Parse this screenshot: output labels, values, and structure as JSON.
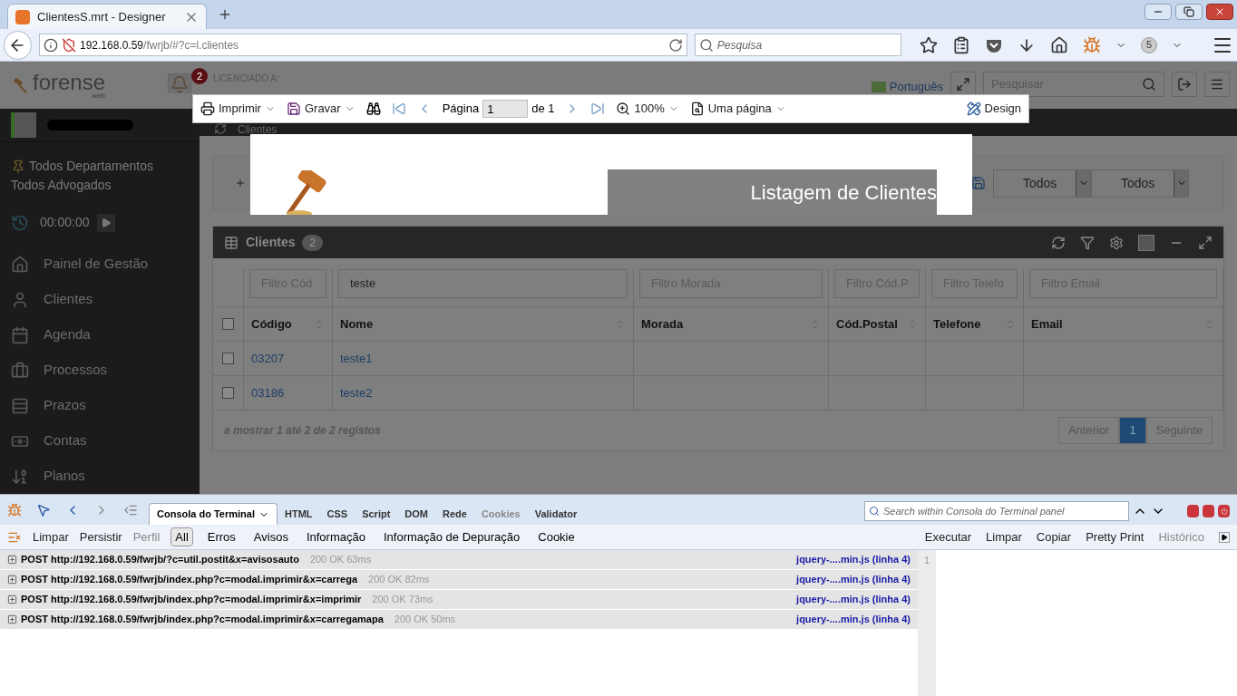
{
  "browser": {
    "tab_title": "ClientesS.mrt - Designer",
    "url_host": "192.168.0.59",
    "url_path": "/fwrjb/#?c=l.clientes",
    "search_placeholder": "Pesquisa",
    "badge": "5"
  },
  "header": {
    "logo": "forense",
    "logo_sub": "web",
    "notifications": "2",
    "licensed_label": "LICENCIADO A:",
    "language": "Português",
    "search_placeholder": "Pesquisar"
  },
  "sidebar": {
    "filters": [
      "Todos Departamentos",
      "Todos Advogados"
    ],
    "timer": "00:00:00",
    "items": [
      {
        "label": "Painel de Gestão",
        "kind": "home"
      },
      {
        "label": "Clientes",
        "kind": "user"
      },
      {
        "label": "Agenda",
        "kind": "calendar"
      },
      {
        "label": "Processos",
        "kind": "briefcase"
      },
      {
        "label": "Prazos",
        "kind": "list"
      },
      {
        "label": "Contas",
        "kind": "money"
      },
      {
        "label": "Planos",
        "kind": "sort"
      }
    ]
  },
  "breadcrumb": "Clientes",
  "selects": [
    "Todos",
    "Todos"
  ],
  "grid": {
    "title": "Clientes",
    "count": "2",
    "select_all": {
      "checked": false
    },
    "filters": [
      {
        "placeholder": "Filtro Cód"
      },
      {
        "value": "teste"
      },
      {
        "placeholder": "Filtro Morada"
      },
      {
        "placeholder": "Filtro Cód.P"
      },
      {
        "placeholder": "Filtro Telefo"
      },
      {
        "placeholder": "Filtro Email"
      }
    ],
    "columns": [
      "Código",
      "Nome",
      "Morada",
      "Cód.Postal",
      "Telefone",
      "Email"
    ],
    "rows": [
      {
        "checked": false,
        "cells": [
          "03207",
          "teste1"
        ]
      },
      {
        "checked": false,
        "cells": [
          "03186",
          "teste2"
        ]
      }
    ],
    "summary": "a mostrar 1 até 2 de 2 registos",
    "pagination": [
      {
        "label": "Anterior",
        "selected": false
      },
      {
        "label": "1",
        "selected": true
      },
      {
        "label": "Seguinte",
        "selected": false
      }
    ]
  },
  "report_viewer": {
    "print": "Imprimir",
    "save": "Gravar",
    "page_label": "Página",
    "page_value": "1",
    "page_of": "de 1",
    "zoom": "100%",
    "view_mode": "Uma página",
    "design": "Design",
    "preview_title": "Listagem de Clientes"
  },
  "devtools": {
    "tabs": [
      {
        "label": "Consola do Terminal",
        "selected": true,
        "disabled": false
      },
      {
        "label": "HTML",
        "selected": false,
        "disabled": false
      },
      {
        "label": "CSS",
        "selected": false,
        "disabled": false
      },
      {
        "label": "Script",
        "selected": false,
        "disabled": false
      },
      {
        "label": "DOM",
        "selected": false,
        "disabled": false
      },
      {
        "label": "Rede",
        "selected": false,
        "disabled": false
      },
      {
        "label": "Cookies",
        "selected": false,
        "disabled": true
      },
      {
        "label": "Validator",
        "selected": false,
        "disabled": false
      }
    ],
    "search_placeholder": "Search within Consola do Terminal panel",
    "actions": [
      {
        "label": "Limpar",
        "disabled": false
      },
      {
        "label": "Persistir",
        "disabled": false
      },
      {
        "label": "Perfil",
        "disabled": true
      }
    ],
    "log_filters": [
      {
        "label": "All",
        "selected": true
      },
      {
        "label": "Erros",
        "selected": false
      },
      {
        "label": "Avisos",
        "selected": false
      },
      {
        "label": "Informação",
        "selected": false
      },
      {
        "label": "Informação de Depuração",
        "selected": false
      },
      {
        "label": "Cookie",
        "selected": false
      }
    ],
    "editor_actions": [
      {
        "label": "Executar",
        "disabled": false
      },
      {
        "label": "Limpar",
        "disabled": false
      },
      {
        "label": "Copiar",
        "disabled": false
      },
      {
        "label": "Pretty Print",
        "disabled": false
      },
      {
        "label": "Histórico",
        "disabled": true
      }
    ],
    "log": [
      {
        "method": "POST",
        "url": "http://192.168.0.59/fwrjb/?c=util.postit&x=avisosauto",
        "status": "200 OK 63ms",
        "source": "jquery-....min.js (linha 4)"
      },
      {
        "method": "POST",
        "url": "http://192.168.0.59/fwrjb/index.php?c=modal.imprimir&x=carrega",
        "status": "200 OK 82ms",
        "source": "jquery-....min.js (linha 4)"
      },
      {
        "method": "POST",
        "url": "http://192.168.0.59/fwrjb/index.php?c=modal.imprimir&x=imprimir",
        "status": "200 OK 73ms",
        "source": "jquery-....min.js (linha 4)"
      },
      {
        "method": "POST",
        "url": "http://192.168.0.59/fwrjb/index.php?c=modal.imprimir&x=carregamapa",
        "status": "200 OK 50ms",
        "source": "jquery-....min.js (linha 4)"
      }
    ],
    "line_numbers": [
      "1"
    ]
  }
}
